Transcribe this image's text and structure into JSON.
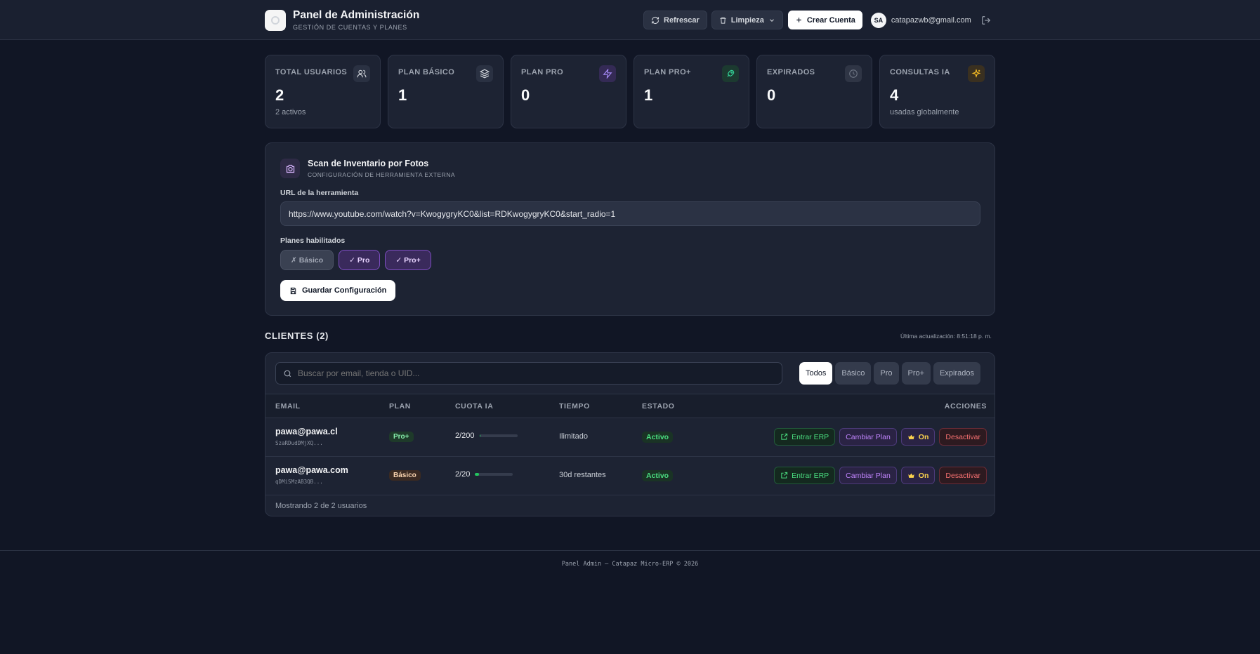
{
  "header": {
    "title": "Panel de Administración",
    "subtitle": "GESTIÓN DE CUENTAS Y PLANES",
    "refresh_label": "Refrescar",
    "cleanup_label": "Limpieza",
    "create_label": "Crear Cuenta",
    "avatar_initials": "SA",
    "user_email": "catapazwb@gmail.com"
  },
  "stats": [
    {
      "label": "TOTAL USUARIOS",
      "value": "2",
      "sub": "2 activos",
      "icon": "users-icon",
      "color": "#d1d5db",
      "bg": "#2a3142"
    },
    {
      "label": "PLAN BÁSICO",
      "value": "1",
      "sub": "",
      "icon": "layers-icon",
      "color": "#d1d5db",
      "bg": "#2a3142"
    },
    {
      "label": "PLAN PRO",
      "value": "0",
      "sub": "",
      "icon": "zap-icon",
      "color": "#a78bfa",
      "bg": "#342a55"
    },
    {
      "label": "PLAN PRO+",
      "value": "1",
      "sub": "",
      "icon": "rocket-icon",
      "color": "#34d399",
      "bg": "#1c3a30"
    },
    {
      "label": "EXPIRADOS",
      "value": "0",
      "sub": "",
      "icon": "clock-icon",
      "color": "#6b7280",
      "bg": "#2f3545"
    },
    {
      "label": "CONSULTAS IA",
      "value": "4",
      "sub": "usadas globalmente",
      "icon": "sparkles-icon",
      "color": "#fbbf24",
      "bg": "#3a3020"
    }
  ],
  "scan": {
    "title": "Scan de Inventario por Fotos",
    "subtitle": "CONFIGURACIÓN DE HERRAMIENTA EXTERNA",
    "url_label": "URL de la herramienta",
    "url_value": "https://www.youtube.com/watch?v=KwogygryKC0&list=RDKwogygryKC0&start_radio=1",
    "plans_label": "Planes habilitados",
    "plans": [
      {
        "label": "✗ Básico",
        "enabled": false
      },
      {
        "label": "✓ Pro",
        "enabled": true
      },
      {
        "label": "✓ Pro+",
        "enabled": true
      }
    ],
    "save_label": "Guardar Configuración"
  },
  "clients": {
    "title": "CLIENTES (2)",
    "last_update": "Última actualización: 8:51:18 p. m.",
    "search_placeholder": "Buscar por email, tienda o UID...",
    "filters": [
      "Todos",
      "Básico",
      "Pro",
      "Pro+",
      "Expirados"
    ],
    "active_filter": "Todos",
    "columns": [
      "EMAIL",
      "PLAN",
      "CUOTA IA",
      "TIEMPO",
      "ESTADO",
      "ACCIONES"
    ],
    "rows": [
      {
        "email": "pawa@pawa.cl",
        "uid": "SzaRDudDMjXQ...",
        "plan": "Pro+",
        "quota": "2/200",
        "quota_fraction": 0.01,
        "time": "Ilimitado",
        "status": "Activo"
      },
      {
        "email": "pawa@pawa.com",
        "uid": "qDMiSMzAB3QB...",
        "plan": "Básico",
        "quota": "2/20",
        "quota_fraction": 0.1,
        "time": "30d restantes",
        "status": "Activo"
      }
    ],
    "row_actions": {
      "erp": "Entrar ERP",
      "change_plan": "Cambiar Plan",
      "toggle": "On",
      "deactivate": "Desactivar"
    },
    "footer": "Mostrando 2 de 2 usuarios"
  },
  "footer": "Panel Admin — Catapaz Micro-ERP © 2026"
}
